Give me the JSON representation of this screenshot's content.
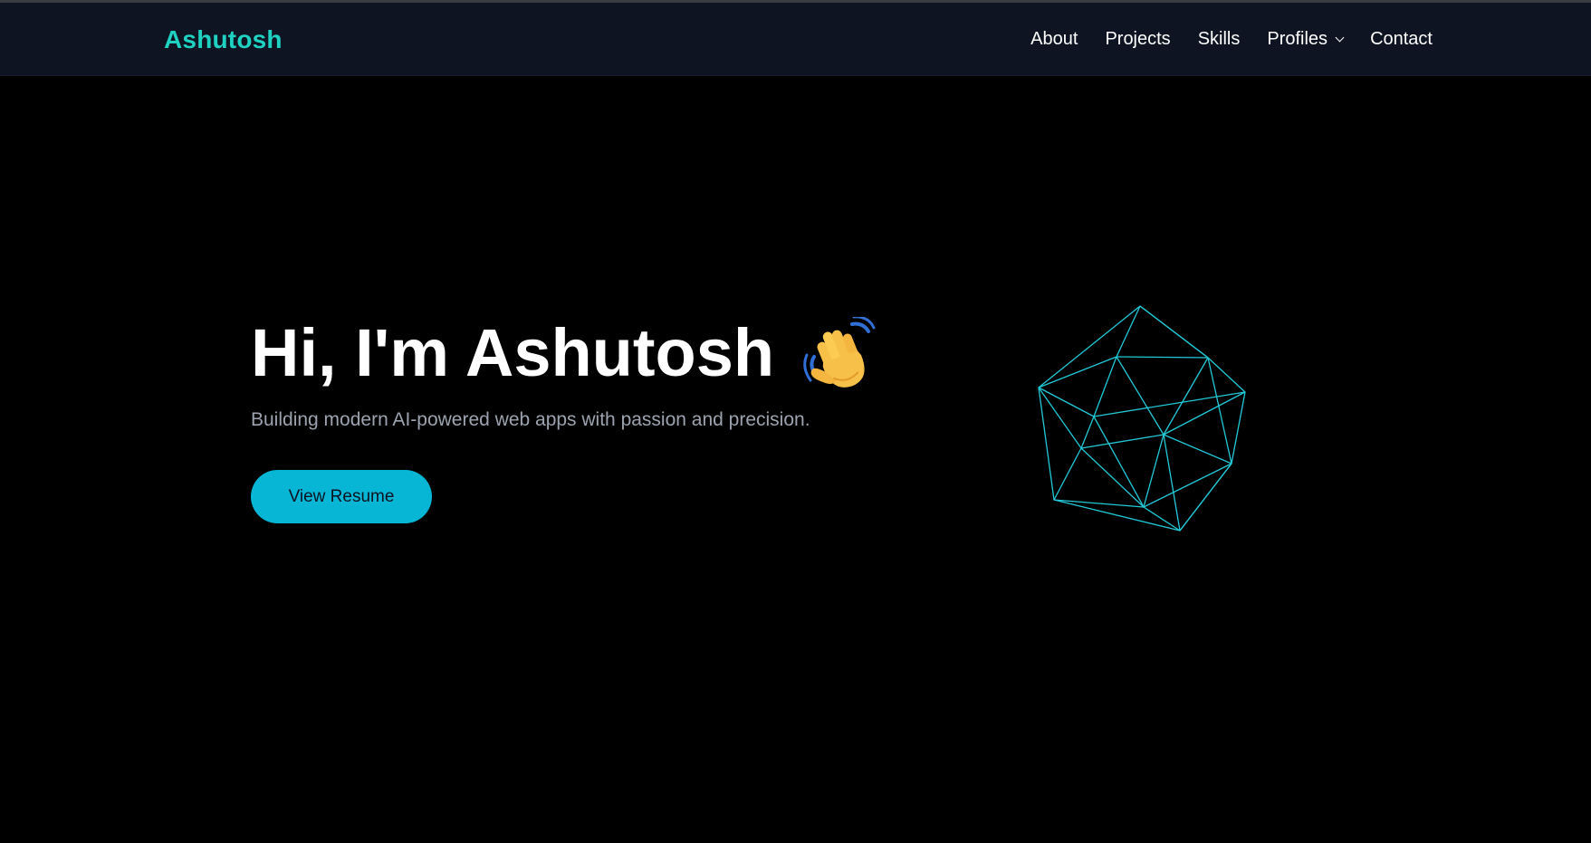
{
  "navbar": {
    "brand": "Ashutosh",
    "links": [
      {
        "label": "About"
      },
      {
        "label": "Projects"
      },
      {
        "label": "Skills"
      },
      {
        "label": "Profiles",
        "has_dropdown": true
      },
      {
        "label": "Contact"
      }
    ]
  },
  "hero": {
    "title": "Hi, I'm Ashutosh",
    "subtitle": "Building modern AI-powered web apps with passion and precision.",
    "cta_label": "View Resume",
    "emoji_icon": "waving-hand-icon",
    "graphic_icon": "icosahedron-wireframe-icon"
  },
  "colors": {
    "brand": "#1fd1c1",
    "navbar_bg": "#0e1421",
    "page_bg": "#000000",
    "button_bg": "#06b6d4",
    "subtitle": "#9ca3af",
    "wireframe": "#22c9d6"
  }
}
